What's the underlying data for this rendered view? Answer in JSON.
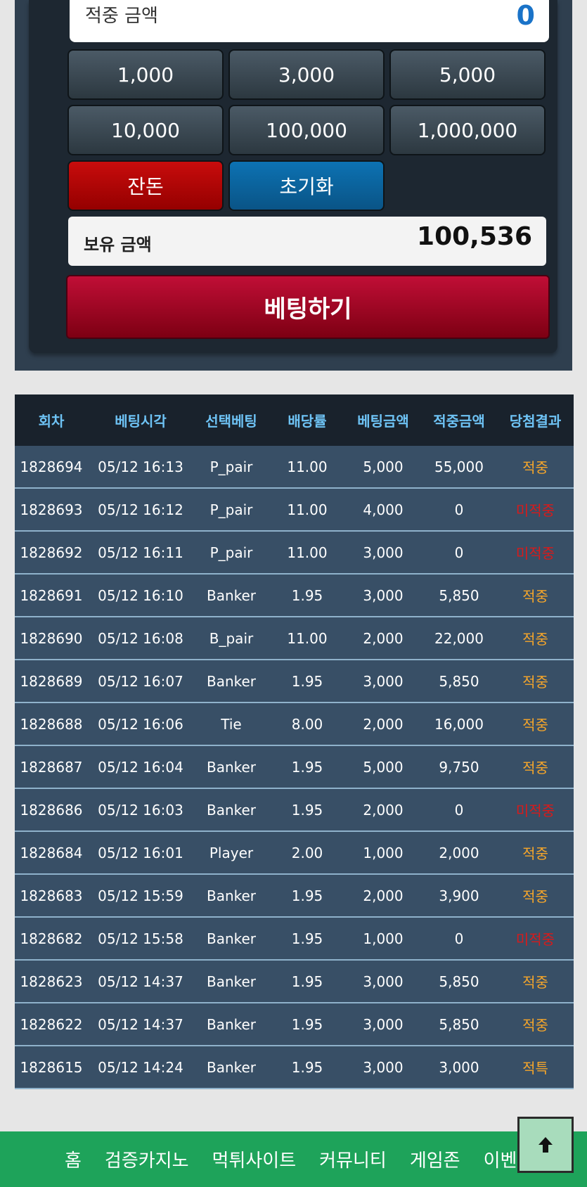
{
  "bet_panel": {
    "win_label": "적중 금액",
    "win_value": "0",
    "chips": [
      "1,000",
      "3,000",
      "5,000",
      "10,000",
      "100,000",
      "1,000,000"
    ],
    "balance_button": "잔돈",
    "reset_button": "초기화",
    "hold_label": "보유 금액",
    "hold_value": "100,536",
    "bet_button": "베팅하기"
  },
  "history": {
    "headers": [
      "회차",
      "베팅시각",
      "선택베팅",
      "배당률",
      "베팅금액",
      "적중금액",
      "당첨결과"
    ],
    "rows": [
      [
        "1828694",
        "05/12 16:13",
        "P_pair",
        "11.00",
        "5,000",
        "55,000",
        "적중"
      ],
      [
        "1828693",
        "05/12 16:12",
        "P_pair",
        "11.00",
        "4,000",
        "0",
        "미적중"
      ],
      [
        "1828692",
        "05/12 16:11",
        "P_pair",
        "11.00",
        "3,000",
        "0",
        "미적중"
      ],
      [
        "1828691",
        "05/12 16:10",
        "Banker",
        "1.95",
        "3,000",
        "5,850",
        "적중"
      ],
      [
        "1828690",
        "05/12 16:08",
        "B_pair",
        "11.00",
        "2,000",
        "22,000",
        "적중"
      ],
      [
        "1828689",
        "05/12 16:07",
        "Banker",
        "1.95",
        "3,000",
        "5,850",
        "적중"
      ],
      [
        "1828688",
        "05/12 16:06",
        "Tie",
        "8.00",
        "2,000",
        "16,000",
        "적중"
      ],
      [
        "1828687",
        "05/12 16:04",
        "Banker",
        "1.95",
        "5,000",
        "9,750",
        "적중"
      ],
      [
        "1828686",
        "05/12 16:03",
        "Banker",
        "1.95",
        "2,000",
        "0",
        "미적중"
      ],
      [
        "1828684",
        "05/12 16:01",
        "Player",
        "2.00",
        "1,000",
        "2,000",
        "적중"
      ],
      [
        "1828683",
        "05/12 15:59",
        "Banker",
        "1.95",
        "2,000",
        "3,900",
        "적중"
      ],
      [
        "1828682",
        "05/12 15:58",
        "Banker",
        "1.95",
        "1,000",
        "0",
        "미적중"
      ],
      [
        "1828623",
        "05/12 14:37",
        "Banker",
        "1.95",
        "3,000",
        "5,850",
        "적중"
      ],
      [
        "1828622",
        "05/12 14:37",
        "Banker",
        "1.95",
        "3,000",
        "5,850",
        "적중"
      ],
      [
        "1828615",
        "05/12 14:24",
        "Banker",
        "1.95",
        "3,000",
        "3,000",
        "적특"
      ]
    ]
  },
  "bottom_nav": [
    "홈",
    "검증카지노",
    "먹튀사이트",
    "커뮤니티",
    "게임존",
    "이벤트"
  ],
  "colors": {
    "win": "#f6a62a",
    "lose": "#d91a1a",
    "nav": "#1ea35a"
  },
  "icons": {
    "scroll_top": "arrow-up-icon"
  }
}
